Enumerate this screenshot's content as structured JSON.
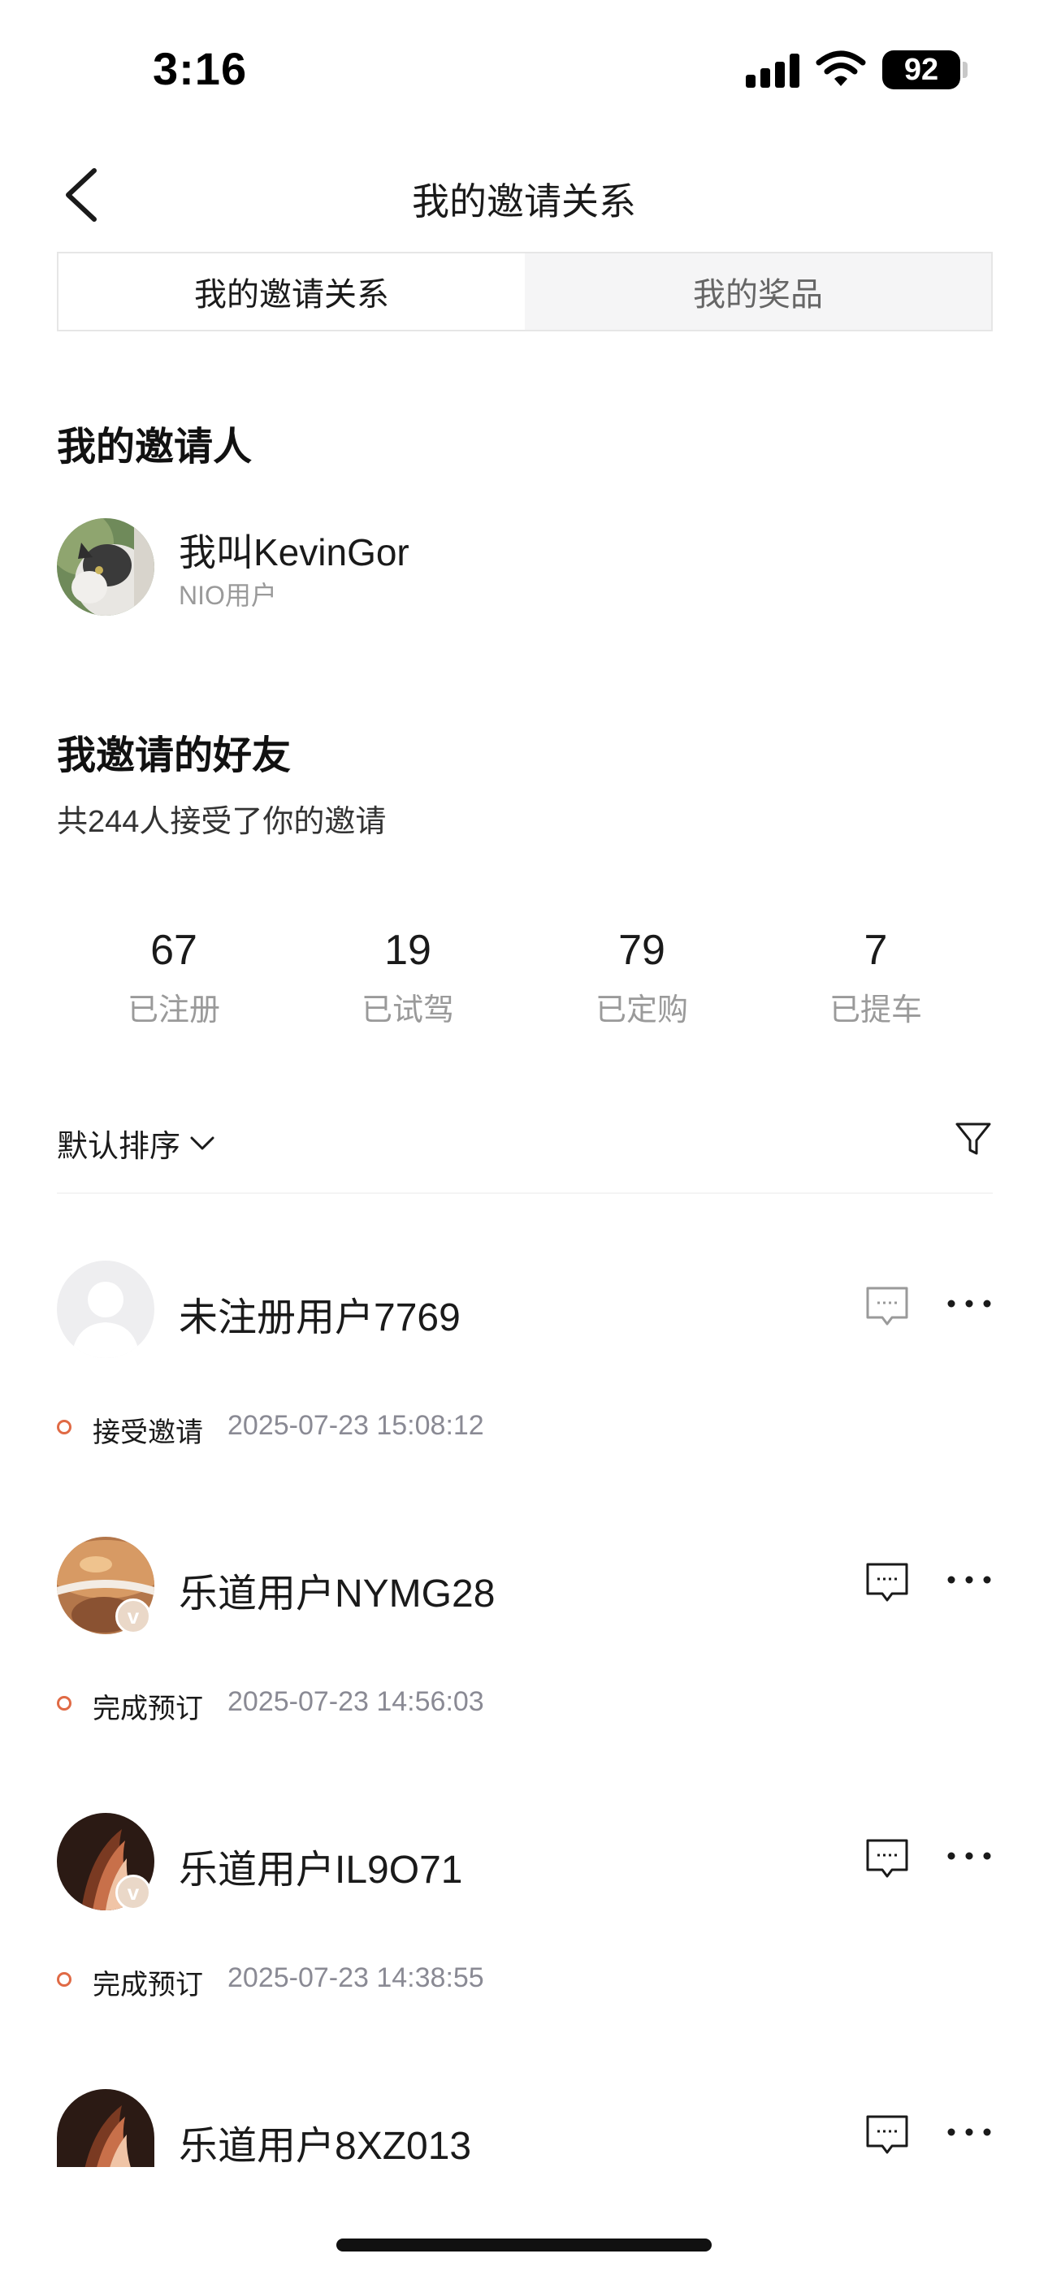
{
  "status_bar": {
    "time": "3:16",
    "battery": "92"
  },
  "nav": {
    "title": "我的邀请关系"
  },
  "tabs": [
    {
      "label": "我的邀请关系",
      "active": true
    },
    {
      "label": "我的奖品",
      "active": false
    }
  ],
  "inviter": {
    "section_title": "我的邀请人",
    "name": "我叫KevinGor",
    "subtitle": "NIO用户"
  },
  "friends": {
    "section_title": "我邀请的好友",
    "summary": "共244人接受了你的邀请",
    "stats": [
      {
        "value": "67",
        "label": "已注册"
      },
      {
        "value": "19",
        "label": "已试驾"
      },
      {
        "value": "79",
        "label": "已定购"
      },
      {
        "value": "7",
        "label": "已提车"
      }
    ]
  },
  "sort": {
    "label": "默认排序"
  },
  "list": [
    {
      "name": "未注册用户7769",
      "status": "接受邀请",
      "time": "2025-07-23 15:08:12",
      "avatar": "placeholder-avatar",
      "verified": false
    },
    {
      "name": "乐道用户NYMG28",
      "status": "完成预订",
      "time": "2025-07-23 14:56:03",
      "avatar": "bronze-avatar",
      "verified": true
    },
    {
      "name": "乐道用户IL9O71",
      "status": "完成预订",
      "time": "2025-07-23 14:38:55",
      "avatar": "dark-avatar",
      "verified": true
    },
    {
      "name": "乐道用户8XZ013",
      "status": "",
      "time": "",
      "avatar": "dark-avatar",
      "verified": false
    }
  ],
  "colors": {
    "accent_dot": "#e06a45",
    "muted_text": "#9a9a9a",
    "tab_inactive_bg": "#f5f5f6"
  },
  "icons": [
    "back-icon",
    "signal-icon",
    "wifi-icon",
    "battery-icon",
    "chevron-down-icon",
    "filter-icon",
    "chat-icon",
    "more-icon"
  ]
}
